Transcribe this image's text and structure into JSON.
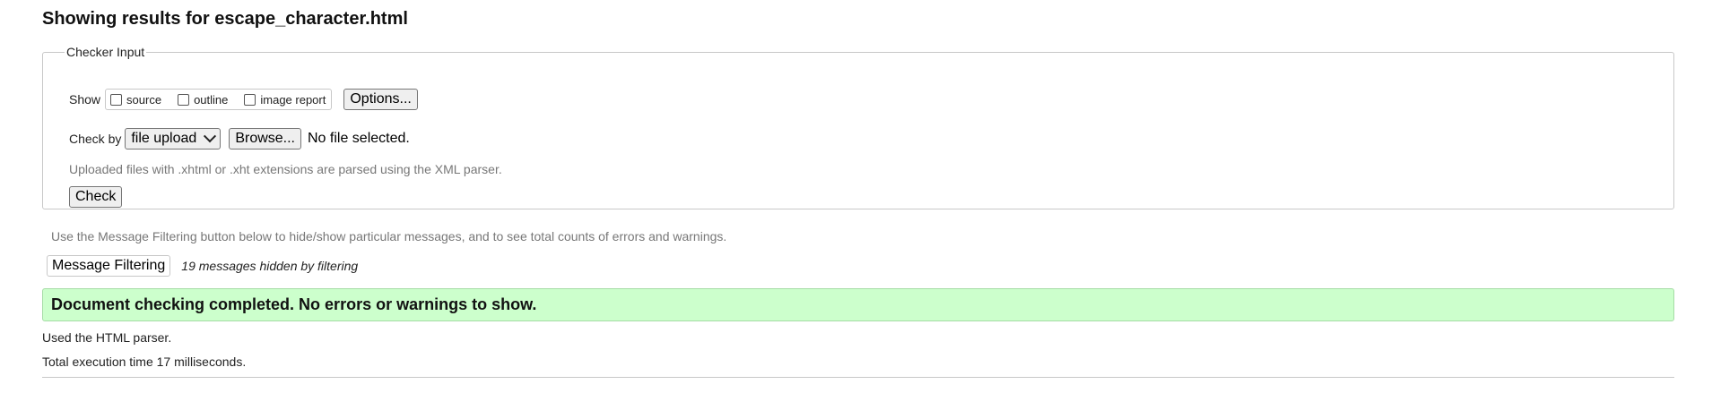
{
  "heading": "Showing results for escape_character.html",
  "checker_input": {
    "legend": "Checker Input",
    "show_label": "Show",
    "show_options": [
      {
        "label": "source",
        "checked": false
      },
      {
        "label": "outline",
        "checked": false
      },
      {
        "label": "image report",
        "checked": false
      }
    ],
    "options_button": "Options...",
    "check_by_label": "Check by",
    "check_by_selected": "file upload",
    "browse_button": "Browse...",
    "file_status": "No file selected.",
    "upload_note": "Uploaded files with .xhtml or .xht extensions are parsed using the XML parser.",
    "check_button": "Check"
  },
  "filtering": {
    "note": "Use the Message Filtering button below to hide/show particular messages, and to see total counts of errors and warnings.",
    "button": "Message Filtering",
    "hidden_count": "19 messages hidden by filtering"
  },
  "result": {
    "message": "Document checking completed. No errors or warnings to show.",
    "color": "#ccffcc"
  },
  "details": {
    "parser": "Used the HTML parser.",
    "execution_time": "Total execution time 17 milliseconds."
  }
}
